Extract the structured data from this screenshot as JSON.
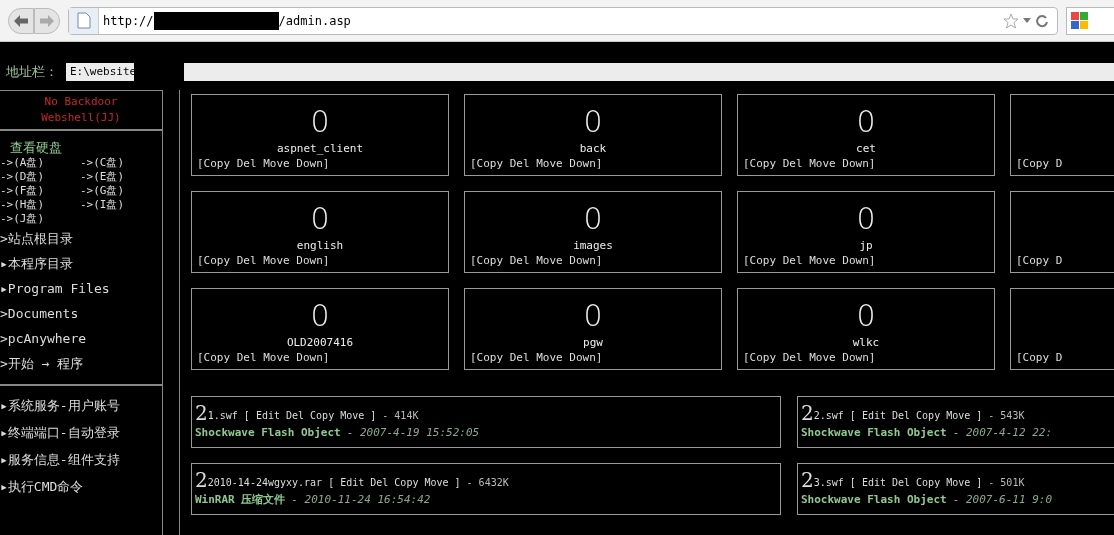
{
  "browser": {
    "url_prefix": "http://",
    "url_suffix": "/admin.asp"
  },
  "address_bar": {
    "label": "地址栏：",
    "value": "E:\\website"
  },
  "sidebar": {
    "title_lines": [
      "No Backdoor",
      "Webshell(JJ)"
    ],
    "section_title": "查看硬盘",
    "drives": [
      "->(A盘)",
      "->(C盘)",
      "->(D盘)",
      "->(E盘)",
      "->(F盘)",
      "->(G盘)",
      "->(H盘)",
      "->(I盘)",
      "->(J盘)"
    ],
    "links": [
      ">站点根目录",
      "▸本程序目录",
      "▸Program Files",
      ">Documents",
      ">pcAnywhere",
      ">开始 → 程序"
    ],
    "tools": [
      "▸系统服务-用户账号",
      "▸终端端口-自动登录",
      "▸服务信息-组件支持",
      "▸执行CMD命令"
    ]
  },
  "folders": [
    {
      "icon": "0",
      "name": "aspnet_client",
      "actions": "[Copy Del Move Down]"
    },
    {
      "icon": "0",
      "name": "back",
      "actions": "[Copy Del Move Down]"
    },
    {
      "icon": "0",
      "name": "cet",
      "actions": "[Copy Del Move Down]"
    },
    {
      "actions": "[Copy D"
    },
    {
      "icon": "0",
      "name": "english",
      "actions": "[Copy Del Move Down]"
    },
    {
      "icon": "0",
      "name": "images",
      "actions": "[Copy Del Move Down]"
    },
    {
      "icon": "0",
      "name": "jp",
      "actions": "[Copy Del Move Down]"
    },
    {
      "actions": "[Copy D"
    },
    {
      "icon": "0",
      "name": "OLD2007416",
      "actions": "[Copy Del Move Down]"
    },
    {
      "icon": "0",
      "name": "pgw",
      "actions": "[Copy Del Move Down]"
    },
    {
      "icon": "0",
      "name": "wlkc",
      "actions": "[Copy Del Move Down]"
    },
    {
      "actions": "[Copy D"
    }
  ],
  "files": [
    {
      "icon": "2",
      "name": "1.swf",
      "actions": "[ Edit Del Copy Move ]",
      "size": "- 414K",
      "type": "Shockwave Flash Object",
      "date": "- 2007-4-19 15:52:05"
    },
    {
      "icon": "2",
      "name": "2.swf",
      "actions": "[ Edit Del Copy Move ]",
      "size": "- 543K",
      "type": "Shockwave Flash Object",
      "date": "- 2007-4-12 22:"
    },
    {
      "icon": "2",
      "name": "2010-14-24wgyxy.rar",
      "actions": "[ Edit Del Copy Move ]",
      "size": "- 6432K",
      "type": "WinRAR 压缩文件",
      "date": "- 2010-11-24 16:54:42"
    },
    {
      "icon": "2",
      "name": "3.swf",
      "actions": "[ Edit Del Copy Move ]",
      "size": "- 501K",
      "type": "Shockwave Flash Object",
      "date": "- 2007-6-11 9:0"
    }
  ]
}
